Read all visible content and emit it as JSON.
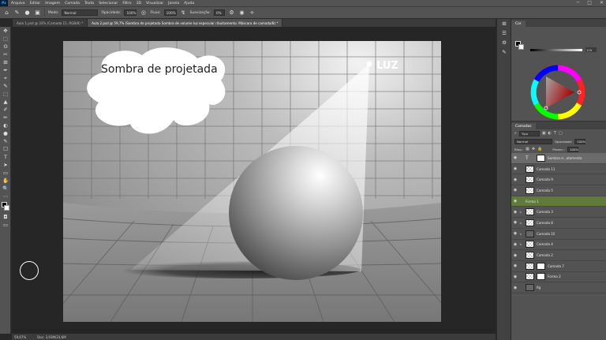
{
  "app": {
    "logo": "Ps"
  },
  "menu": [
    "Arquivo",
    "Editar",
    "Imagem",
    "Camada",
    "Texto",
    "Selecionar",
    "Filtro",
    "3D",
    "Visualizar",
    "Janela",
    "Ajuda"
  ],
  "window_controls": [
    "─",
    "□",
    "✕"
  ],
  "options": {
    "brush_size": "",
    "mode_label": "Modo:",
    "mode_value": "Normal",
    "opacity_label": "Opacidade:",
    "opacity_value": "100%",
    "flow_label": "Fluxo:",
    "flow_value": "100%",
    "smoothing_label": "Suavização:",
    "smoothing_value": "0%"
  },
  "tabs": [
    {
      "label": "Aula 1.psd @ 33% (Camada 15, RGB/8) *",
      "active": false
    },
    {
      "label": "Aula 2.psd @ 59,7% (Sombra de projetada Sombra de volume  luz especular ribuitamento. Máscara de camada/8) *",
      "active": true
    }
  ],
  "canvas": {
    "bubble_text": "Sombra de projetada",
    "light_text": "LUZ"
  },
  "status": {
    "zoom": "59,67%",
    "doc": "Doc: 3,93M/23,6M"
  },
  "panels": {
    "color_tab": "Cor",
    "color_value": "100",
    "layers_tab": "Camadas",
    "filter_label": "Tipo",
    "blend_mode": "Normal",
    "opacity_label": "Opacidade:",
    "opacity_value": "100%",
    "lock_label": "Bloq.:",
    "fill_label": "Preenc.:",
    "fill_value": "100%"
  },
  "layers": [
    {
      "name": "Sombra d...atamento",
      "kind": "text",
      "selected": true,
      "visible": true,
      "clip": false,
      "indent": false
    },
    {
      "name": "Camada 11",
      "kind": "pixel",
      "selected": false,
      "visible": true,
      "clip": false,
      "indent": false
    },
    {
      "name": "Camada 9",
      "kind": "pixel",
      "selected": false,
      "visible": true,
      "clip": false,
      "indent": false
    },
    {
      "name": "Camada 5",
      "kind": "pixel",
      "selected": false,
      "visible": true,
      "clip": false,
      "indent": false
    },
    {
      "name": "Forma 1",
      "kind": "shape",
      "selected": false,
      "visible": true,
      "clip": false,
      "indent": false
    },
    {
      "name": "Camada 3",
      "kind": "pixel",
      "selected": false,
      "visible": true,
      "clip": true,
      "indent": true
    },
    {
      "name": "Camada 8",
      "kind": "pixel",
      "selected": false,
      "visible": true,
      "clip": true,
      "indent": true
    },
    {
      "name": "Camada 10",
      "kind": "dark",
      "selected": false,
      "visible": true,
      "clip": true,
      "indent": true
    },
    {
      "name": "Camada 4",
      "kind": "pixel",
      "selected": false,
      "visible": true,
      "clip": true,
      "indent": true
    },
    {
      "name": "Camada 2",
      "kind": "pixel",
      "selected": false,
      "visible": true,
      "clip": false,
      "indent": false
    },
    {
      "name": "Camada 7",
      "kind": "masked",
      "selected": false,
      "visible": true,
      "clip": false,
      "indent": false
    },
    {
      "name": "Forma 2",
      "kind": "masked",
      "selected": false,
      "visible": true,
      "clip": false,
      "indent": false
    },
    {
      "name": "fig",
      "kind": "dark",
      "selected": false,
      "visible": true,
      "clip": false,
      "indent": false
    }
  ],
  "tools": [
    "✥",
    "⬚",
    "ʘ",
    "✂",
    "⊞",
    "✒",
    "⌖",
    "✎",
    "⬚",
    "▲",
    "✐",
    "✏",
    "◐",
    "●",
    "✎",
    "☐",
    "T",
    "➤",
    "▭",
    "✋",
    "🔍",
    "⋯"
  ],
  "mid_tools": [
    "⊞",
    "☰",
    "⚙",
    "✎"
  ]
}
